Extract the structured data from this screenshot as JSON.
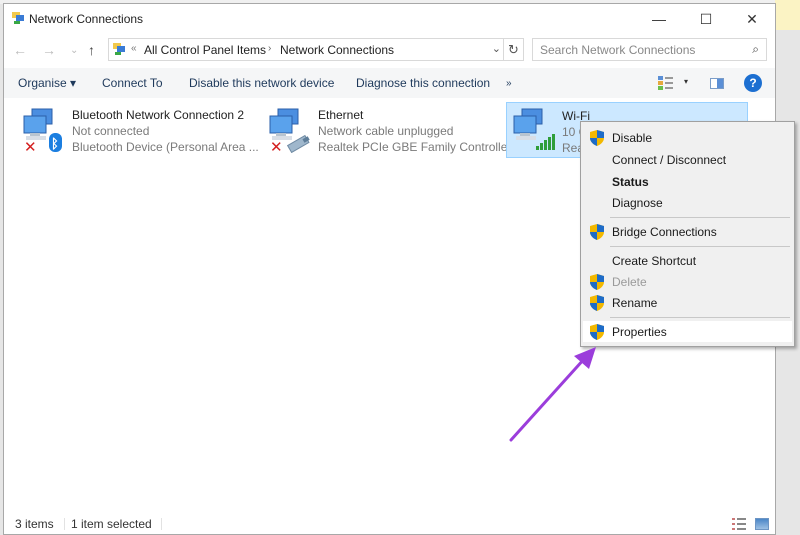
{
  "window": {
    "title": "Network Connections",
    "controls": {
      "minimize": "—",
      "maximize": "☐",
      "close": "✕"
    }
  },
  "navigation": {
    "back": "←",
    "forward": "→",
    "recent": "⌄",
    "up": "↑",
    "address": {
      "overflow": "«",
      "crumbs": [
        "All Control Panel Items",
        "Network Connections"
      ],
      "separator": "›",
      "dropdown": "⌄"
    },
    "refresh": "↻",
    "search": {
      "placeholder": "Search Network Connections",
      "value": "",
      "icon": "⌕"
    }
  },
  "toolbar": {
    "organise": "Organise ▾",
    "connect_to": "Connect To",
    "disable": "Disable this network device",
    "diagnose": "Diagnose this connection",
    "more": "»",
    "view_dropdown": "▾",
    "help": "?"
  },
  "connections": [
    {
      "name": "Bluetooth Network Connection 2",
      "status": "Not connected",
      "device": "Bluetooth Device (Personal Area ...",
      "badge": "bluetooth",
      "disconnected": true,
      "selected": false
    },
    {
      "name": "Ethernet",
      "status": "Network cable unplugged",
      "device": "Realtek PCIe GBE Family Controller",
      "badge": "ethernet-cable",
      "disconnected": true,
      "selected": false
    },
    {
      "name": "Wi-Fi",
      "status": "10 C",
      "device": "Rea",
      "badge": "signal-bars",
      "disconnected": false,
      "selected": true
    }
  ],
  "context_menu": {
    "items": [
      {
        "label": "Disable",
        "shield": true,
        "bold": false,
        "disabled": false
      },
      {
        "label": "Connect / Disconnect",
        "shield": false,
        "bold": false,
        "disabled": false
      },
      {
        "label": "Status",
        "shield": false,
        "bold": true,
        "disabled": false
      },
      {
        "label": "Diagnose",
        "shield": false,
        "bold": false,
        "disabled": false
      },
      {
        "label": "Bridge Connections",
        "shield": true,
        "bold": false,
        "disabled": false
      },
      {
        "label": "Create Shortcut",
        "shield": false,
        "bold": false,
        "disabled": false
      },
      {
        "label": "Delete",
        "shield": true,
        "bold": false,
        "disabled": true
      },
      {
        "label": "Rename",
        "shield": true,
        "bold": false,
        "disabled": false
      },
      {
        "label": "Properties",
        "shield": true,
        "bold": false,
        "disabled": false,
        "highlighted": true
      }
    ]
  },
  "statusbar": {
    "item_count": "3 items",
    "selection": "1 item selected"
  },
  "annotation": {
    "arrow_color": "#9b3ddb",
    "points_to": "Properties"
  },
  "colors": {
    "selection_bg": "#cce8ff",
    "selection_border": "#99d1ff",
    "toolbar_bg": "#f5f6f7",
    "menu_bg": "#f0f0f0",
    "help_blue": "#1c6fd1"
  }
}
